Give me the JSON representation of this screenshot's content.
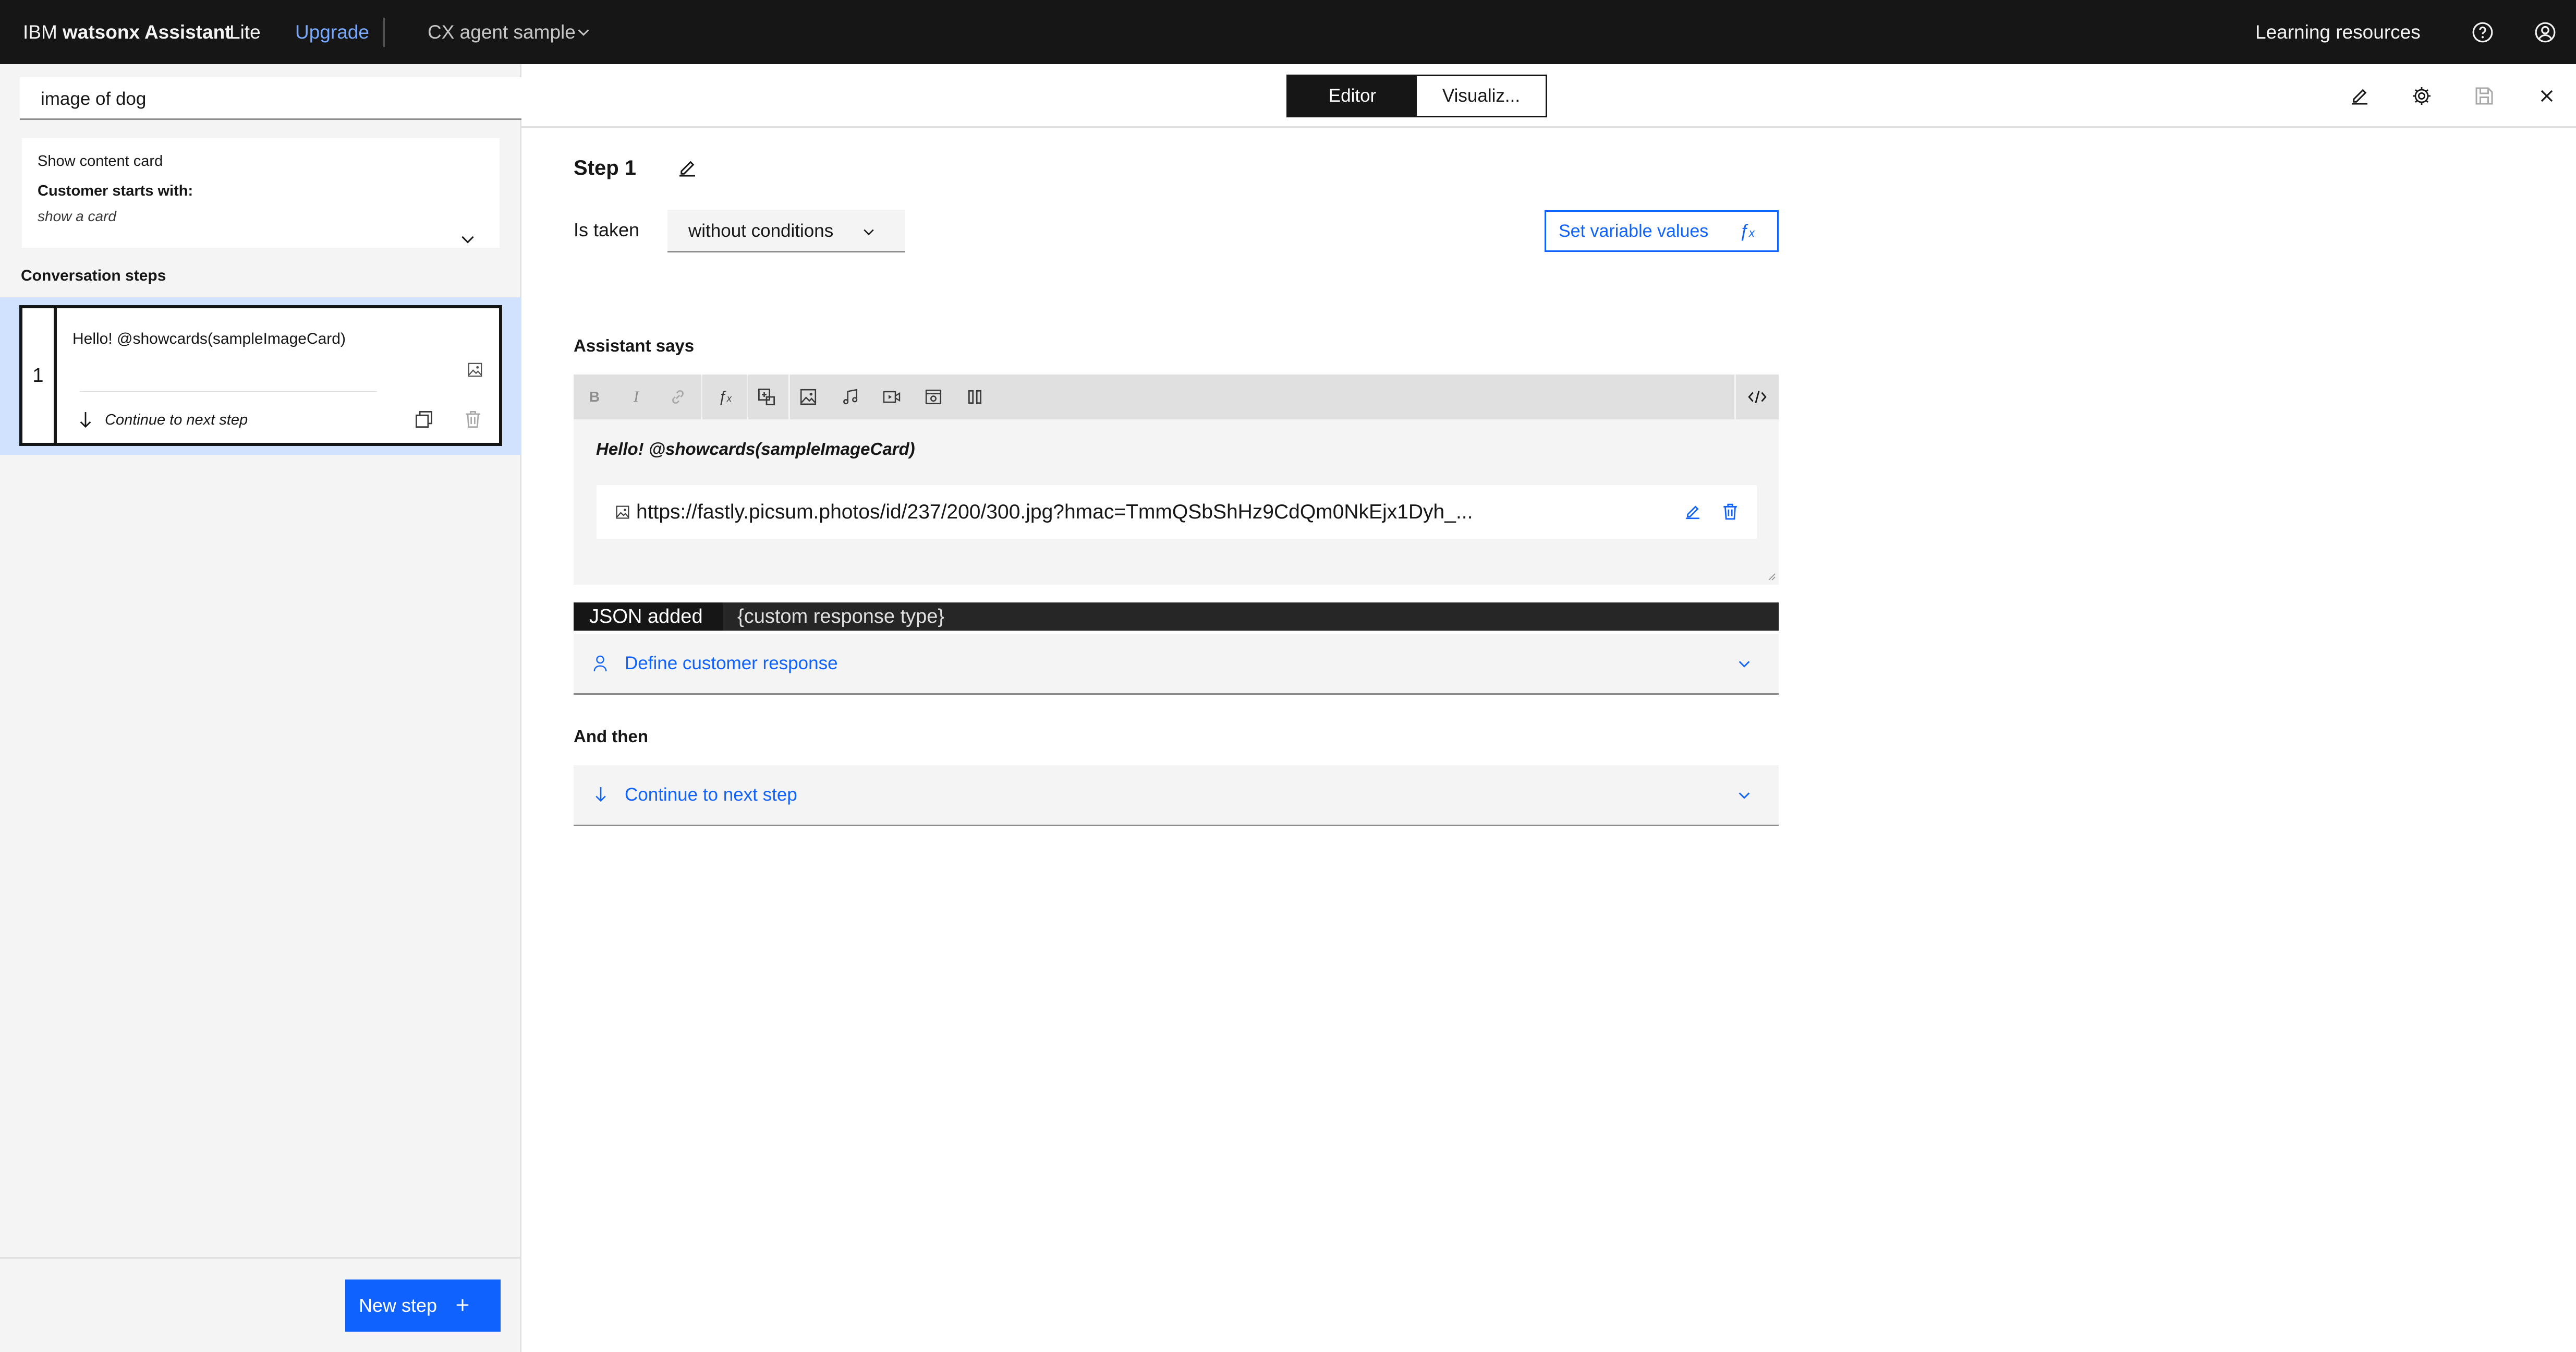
{
  "topbar": {
    "brand_prefix": "IBM",
    "brand_name": "watsonx Assistant",
    "plan": "Lite",
    "upgrade": "Upgrade",
    "assistant_name": "CX agent sample",
    "learning": "Learning resources"
  },
  "sidebar": {
    "action_name": "image of dog",
    "trigger_type": "Show content card",
    "customer_starts_label": "Customer starts with:",
    "customer_starts_value": "show a card",
    "conversation_steps": "Conversation steps",
    "steps": [
      {
        "number": "1",
        "text": "Hello! @showcards(sampleImageCard)",
        "next": "Continue to next step"
      }
    ],
    "new_step": "New step"
  },
  "header": {
    "tab_editor": "Editor",
    "tab_visualizer": "Visualiz..."
  },
  "main": {
    "step_title": "Step 1",
    "is_taken": "Is taken",
    "condition": "without conditions",
    "set_variable_values": "Set variable values",
    "assistant_says": "Assistant says",
    "message": "Hello! @showcards(sampleImageCard)",
    "image_url": "https://fastly.picsum.photos/id/237/200/300.jpg?hmac=TmmQSbShHz9CdQm0NkEjx1Dyh_...",
    "json_added": "JSON added",
    "custom_response": "{custom response type}",
    "define_customer_response": "Define customer response",
    "and_then": "And then",
    "continue_next": "Continue to next step"
  },
  "colors": {
    "accent": "#0f62fe",
    "topbar": "#161616",
    "selected_row": "#d0e2ff",
    "field_bg": "#f4f4f4"
  }
}
